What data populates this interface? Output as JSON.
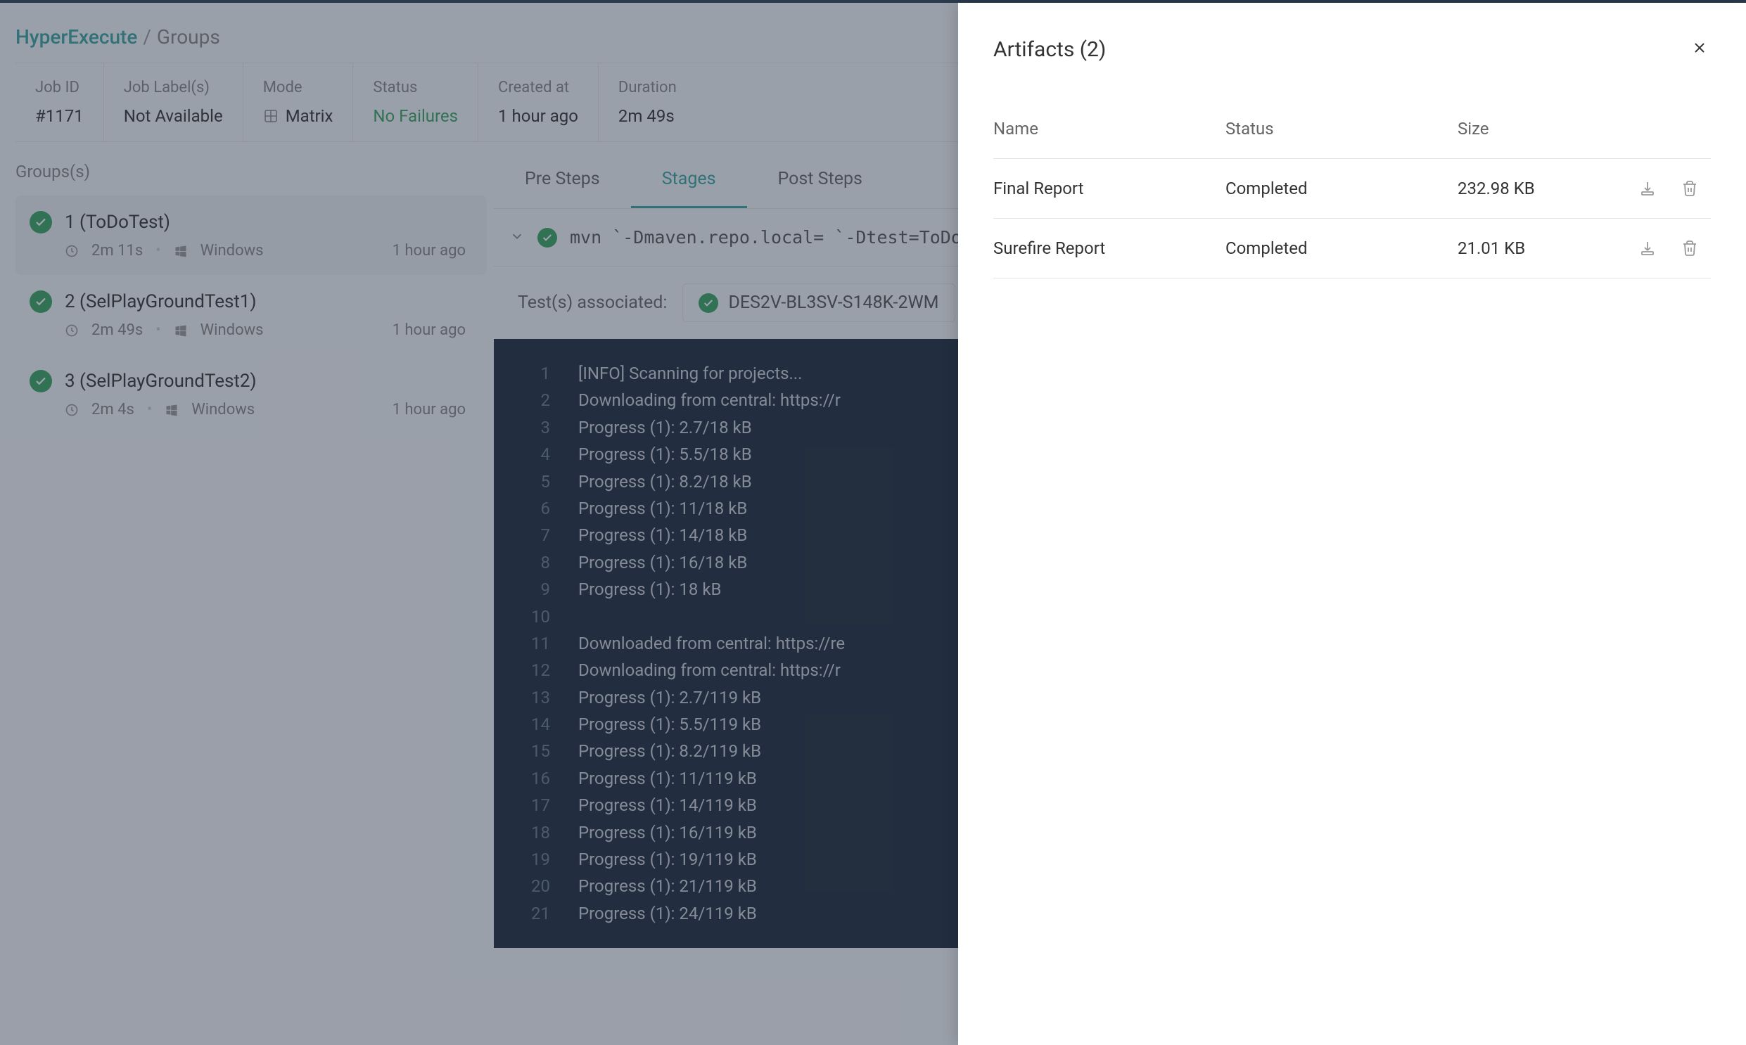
{
  "breadcrumb": {
    "root": "HyperExecute",
    "separator": "/",
    "current": "Groups"
  },
  "job_info": {
    "id_label": "Job ID",
    "id_value": "#1171",
    "labels_label": "Job Label(s)",
    "labels_value": "Not Available",
    "mode_label": "Mode",
    "mode_value": "Matrix",
    "status_label": "Status",
    "status_value": "No Failures",
    "created_label": "Created at",
    "created_value": "1 hour ago",
    "duration_label": "Duration",
    "duration_value": "2m 49s"
  },
  "sidebar": {
    "title": "Groups(s)",
    "items": [
      {
        "name": "1 (ToDoTest)",
        "duration": "2m 11s",
        "os": "Windows",
        "time": "1 hour ago"
      },
      {
        "name": "2 (SelPlayGroundTest1)",
        "duration": "2m 49s",
        "os": "Windows",
        "time": "1 hour ago"
      },
      {
        "name": "3 (SelPlayGroundTest2)",
        "duration": "2m 4s",
        "os": "Windows",
        "time": "1 hour ago"
      }
    ]
  },
  "tabs": {
    "pre": "Pre Steps",
    "stages": "Stages",
    "post": "Post Steps"
  },
  "command": "mvn `-Dmaven.repo.local= `-Dtest=ToDoTest t",
  "associated": {
    "label": "Test(s) associated:",
    "test_id": "DES2V-BL3SV-S148K-2WM"
  },
  "log_lines": [
    "[INFO] Scanning for projects...",
    "Downloading from central: https://r",
    "Progress (1): 2.7/18 kB",
    "Progress (1): 5.5/18 kB",
    "Progress (1): 8.2/18 kB",
    "Progress (1): 11/18 kB",
    "Progress (1): 14/18 kB",
    "Progress (1): 16/18 kB",
    "Progress (1): 18 kB",
    "",
    "Downloaded from central: https://re",
    "Downloading from central: https://r",
    "Progress (1): 2.7/119 kB",
    "Progress (1): 5.5/119 kB",
    "Progress (1): 8.2/119 kB",
    "Progress (1): 11/119 kB",
    "Progress (1): 14/119 kB",
    "Progress (1): 16/119 kB",
    "Progress (1): 19/119 kB",
    "Progress (1): 21/119 kB",
    "Progress (1): 24/119 kB"
  ],
  "drawer": {
    "title": "Artifacts (2)",
    "cols": {
      "name": "Name",
      "status": "Status",
      "size": "Size"
    },
    "rows": [
      {
        "name": "Final Report",
        "status": "Completed",
        "size": "232.98 KB"
      },
      {
        "name": "Surefire Report",
        "status": "Completed",
        "size": "21.01 KB"
      }
    ]
  }
}
